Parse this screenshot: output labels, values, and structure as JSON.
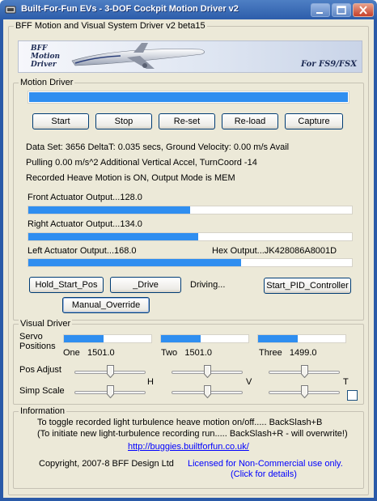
{
  "window": {
    "title": "Built-For-Fun EVs - 3-DOF Cockpit Motion Driver v2",
    "minimize_icon": "minimize-icon",
    "maximize_icon": "maximize-icon",
    "close_icon": "close-icon"
  },
  "header": {
    "group_title": "BFF Motion and Visual System Driver v2 beta15",
    "logo_text": "BFF\nMotion\nDriver",
    "banner_tagline": "For FS9/FSX",
    "airplane_icon": "airplane-icon"
  },
  "motion_driver": {
    "group_title": "Motion Driver",
    "top_progress": 1.0,
    "buttons": {
      "start": "Start",
      "stop": "Stop",
      "reset": "Re-set",
      "reload": "Re-load",
      "capture": "Capture"
    },
    "status": {
      "line1": "Data Set: 3656  DeltaT: 0.035 secs, Ground Velocity: 0.00 m/s Avail",
      "line2": "Pulling 0.00 m/s^2 Additional Vertical Accel, TurnCoord -14",
      "line3": "Recorded Heave Motion is ON, Output Mode is MEM"
    },
    "actuators": {
      "front_label": "Front Actuator Output...128.0",
      "front_level": 0.5,
      "right_label": "Right Actuator Output...134.0",
      "right_level": 0.525,
      "left_label": "Left Actuator Output...168.0",
      "left_level": 0.658,
      "hex_label": "Hex Output...JK428086A8001D"
    },
    "hold_start_pos": "Hold_Start_Pos",
    "drive": "_Drive",
    "driving_status": "Driving...",
    "start_pid": "Start_PID_Controller",
    "manual_override": "Manual_Override"
  },
  "visual_driver": {
    "group_title": "Visual Driver",
    "servo_positions_label": "Servo\nPositions",
    "servos": [
      {
        "label": "One   1501.0",
        "level": 0.45
      },
      {
        "label": "Two   1501.0",
        "level": 0.45
      },
      {
        "label": "Three   1499.0",
        "level": 0.45
      }
    ],
    "pos_adjust_label": "Pos Adjust",
    "simp_scale_label": "Simp Scale",
    "axis_h": "H",
    "axis_v": "V",
    "axis_t": "T",
    "pos_adjust_values": [
      0.5,
      0.5,
      0.5
    ],
    "simp_scale_values": [
      0.5,
      0.5,
      0.5
    ],
    "t_checked": false
  },
  "information": {
    "group_title": "Information",
    "line1": "To toggle recorded light turbulence heave motion on/off.....  BackSlash+B",
    "line2": "(To initiate new light-turbulence recording run.....  BackSlash+R - will overwrite!)",
    "url": "http://buggies.builtforfun.co.uk/",
    "copyright": "Copyright, 2007-8 BFF Design Ltd",
    "license_line1": "Licensed for Non-Commercial use only.",
    "license_line2": "(Click for details)"
  },
  "colors": {
    "title_bar": "#2a5aa8",
    "progress": "#2f8ef0",
    "window_bg": "#ece9d8",
    "link": "#0000ff"
  }
}
